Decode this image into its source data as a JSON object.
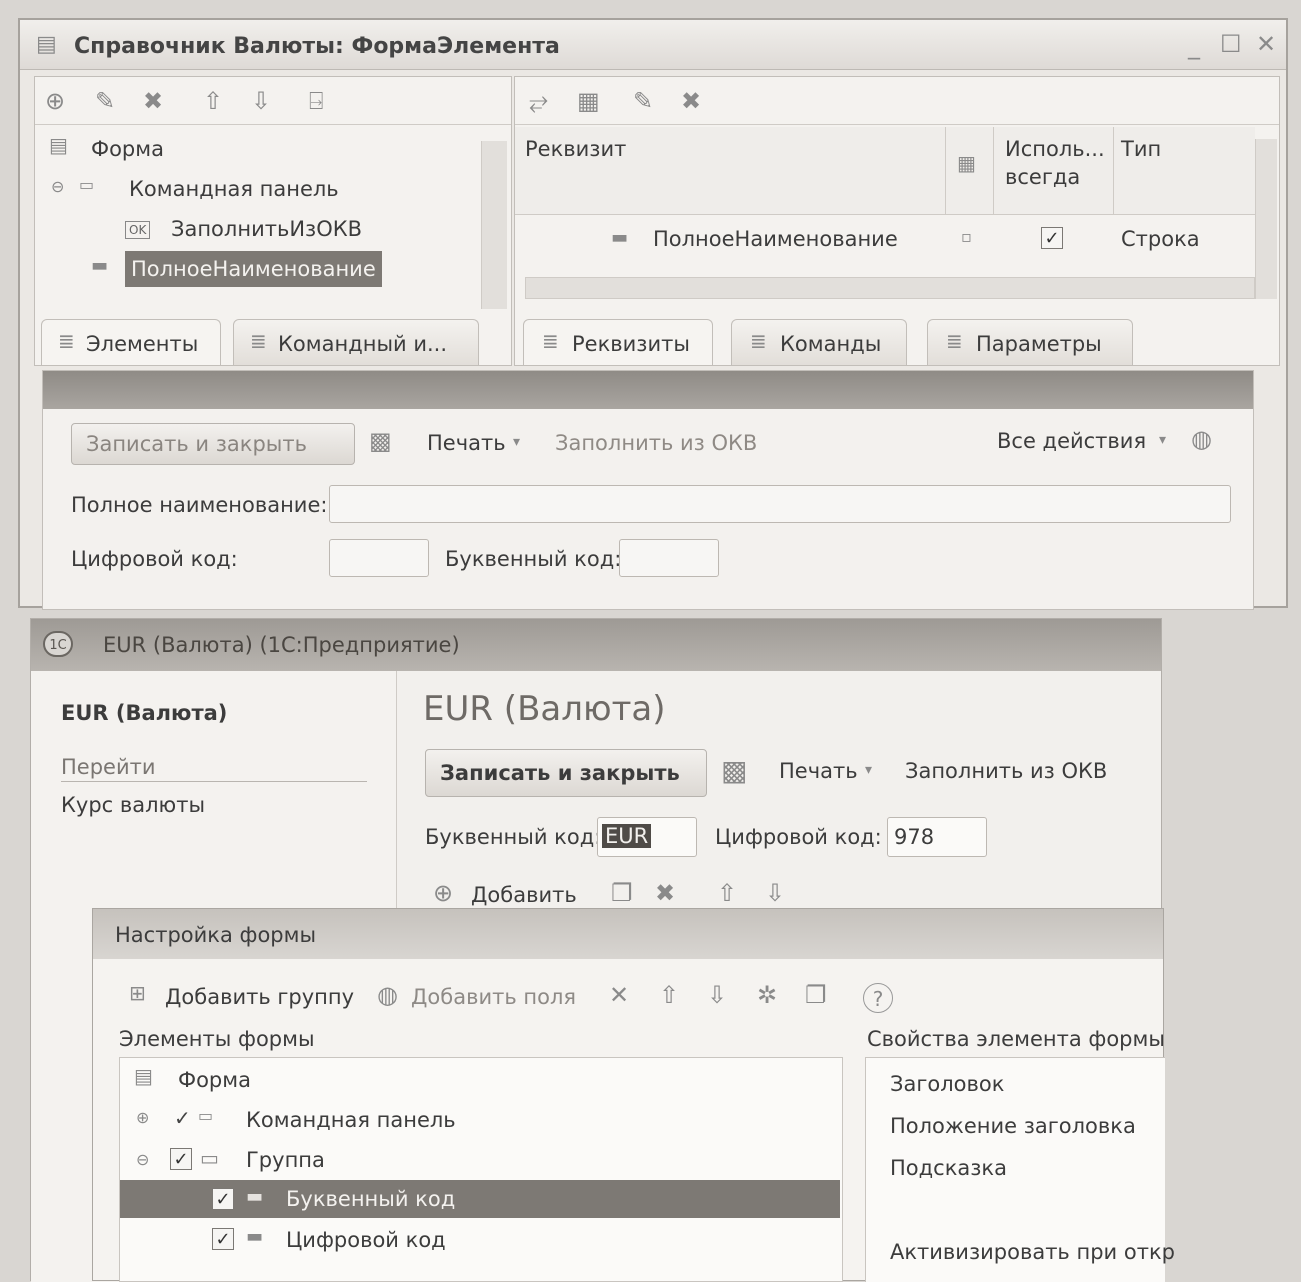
{
  "designer": {
    "title": "Справочник Валюты: ФормаЭлемента",
    "tree": {
      "root": "Форма",
      "command_panel": "Командная панель",
      "ok_badge": "OK",
      "fill_cmd": "ЗаполнитьИзОКВ",
      "full_name": "ПолноеНаименование"
    },
    "left_tabs": [
      "Элементы",
      "Командный и..."
    ],
    "grid": {
      "col_rekvizit": "Реквизит",
      "col_ispol": "Исполь... всегда",
      "col_tip": "Тип",
      "row_name": "ПолноеНаименование",
      "row_type": "Строка"
    },
    "right_tabs": [
      "Реквизиты",
      "Команды",
      "Параметры"
    ],
    "preview": {
      "save_close": "Записать и закрыть",
      "print": "Печать",
      "fill": "Заполнить из ОКВ",
      "all_actions": "Все действия",
      "full_name_label": "Полное наименование:",
      "digital_label": "Цифровой код:",
      "letter_label": "Буквенный код:"
    }
  },
  "enterprise": {
    "logo": "1С",
    "title": "EUR (Валюта)  (1С:Предприятие)",
    "nav_title": "EUR (Валюта)",
    "nav_goto": "Перейти",
    "nav_rate": "Курс валюты",
    "heading": "EUR (Валюта)",
    "save_close": "Записать и закрыть",
    "print": "Печать",
    "fill": "Заполнить из ОКВ",
    "letter_label": "Буквенный код:",
    "letter_value": "EUR",
    "digital_label": "Цифровой код:",
    "digital_value": "978",
    "add": "Добавить"
  },
  "settings": {
    "title": "Настройка формы",
    "add_group": "Добавить группу",
    "add_field": "Добавить поля",
    "elements_title": "Элементы формы",
    "props_title": "Свойства элемента формы",
    "tree": {
      "root": "Форма",
      "command_panel": "Командная панель",
      "group": "Группа",
      "letter_code": "Буквенный код",
      "digital_code": "Цифровой код"
    },
    "props": [
      "Заголовок",
      "Положение заголовка",
      "Подсказка",
      "Активизировать при откр"
    ]
  }
}
